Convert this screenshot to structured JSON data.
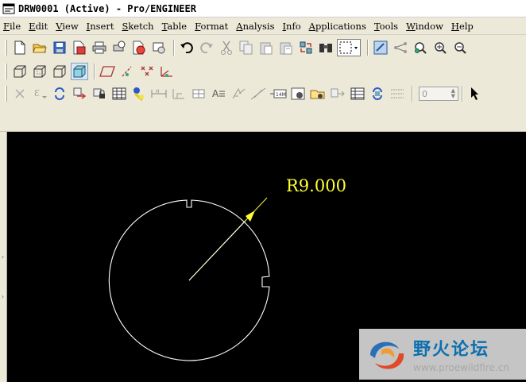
{
  "window": {
    "title": "DRW0001 (Active) - Pro/ENGINEER"
  },
  "menu": [
    {
      "ul": "F",
      "rest": "ile"
    },
    {
      "ul": "E",
      "rest": "dit"
    },
    {
      "ul": "V",
      "rest": "iew"
    },
    {
      "ul": "I",
      "rest": "nsert"
    },
    {
      "ul": "S",
      "rest": "ketch"
    },
    {
      "ul": "T",
      "rest": "able"
    },
    {
      "ul": "F",
      "rest": "ormat"
    },
    {
      "ul": "A",
      "rest": "nalysis"
    },
    {
      "ul": "I",
      "rest": "nfo"
    },
    {
      "ul": "A",
      "rest": "pplications"
    },
    {
      "ul": "T",
      "rest": "ools"
    },
    {
      "ul": "W",
      "rest": "indow"
    },
    {
      "ul": "H",
      "rest": "elp"
    }
  ],
  "toolbar1": [
    "new-file-icon",
    "open-folder-icon",
    "save-icon",
    "save-copy-icon",
    "print-icon",
    "print-preview-icon",
    "pdf-export-icon",
    "send-mail-icon",
    "undo-icon",
    "redo-icon",
    "cut-icon",
    "copy-icon",
    "paste-icon",
    "paste-special-icon",
    "regenerate-icon",
    "find-icon",
    "select-box-icon",
    "repaint-icon",
    "spin-center-icon",
    "zoom-fit-icon",
    "zoom-in-icon",
    "zoom-out-icon"
  ],
  "toolbar2": [
    "wireframe-icon",
    "hidden-line-icon",
    "no-hidden-icon",
    "shading-icon",
    "datum-plane-icon",
    "datum-axis-icon",
    "datum-point-icon",
    "coord-sys-icon"
  ],
  "toolbar3": [
    "delete-icon",
    "show-axes-icon",
    "update-icon",
    "move-view-icon",
    "lock-view-icon",
    "table-icon",
    "note-icon",
    "dimension-icon",
    "ordinate-icon",
    "tolerance-icon",
    "surface-finish-icon",
    "text-style-icon",
    "symbol-icon",
    "edit-icon",
    "detail-view-icon",
    "cross-section-icon",
    "arrow-icon",
    "layer-icon",
    "grid-icon",
    "refresh-icon",
    "list-icon"
  ],
  "spinbox": {
    "value": "0"
  },
  "drawing": {
    "dimension_label": "R9.000",
    "line_color": "#ffffff",
    "dim_color": "#ffff33"
  },
  "watermark": {
    "cn": "野火论坛",
    "url": "www.proewildfire.cn"
  }
}
